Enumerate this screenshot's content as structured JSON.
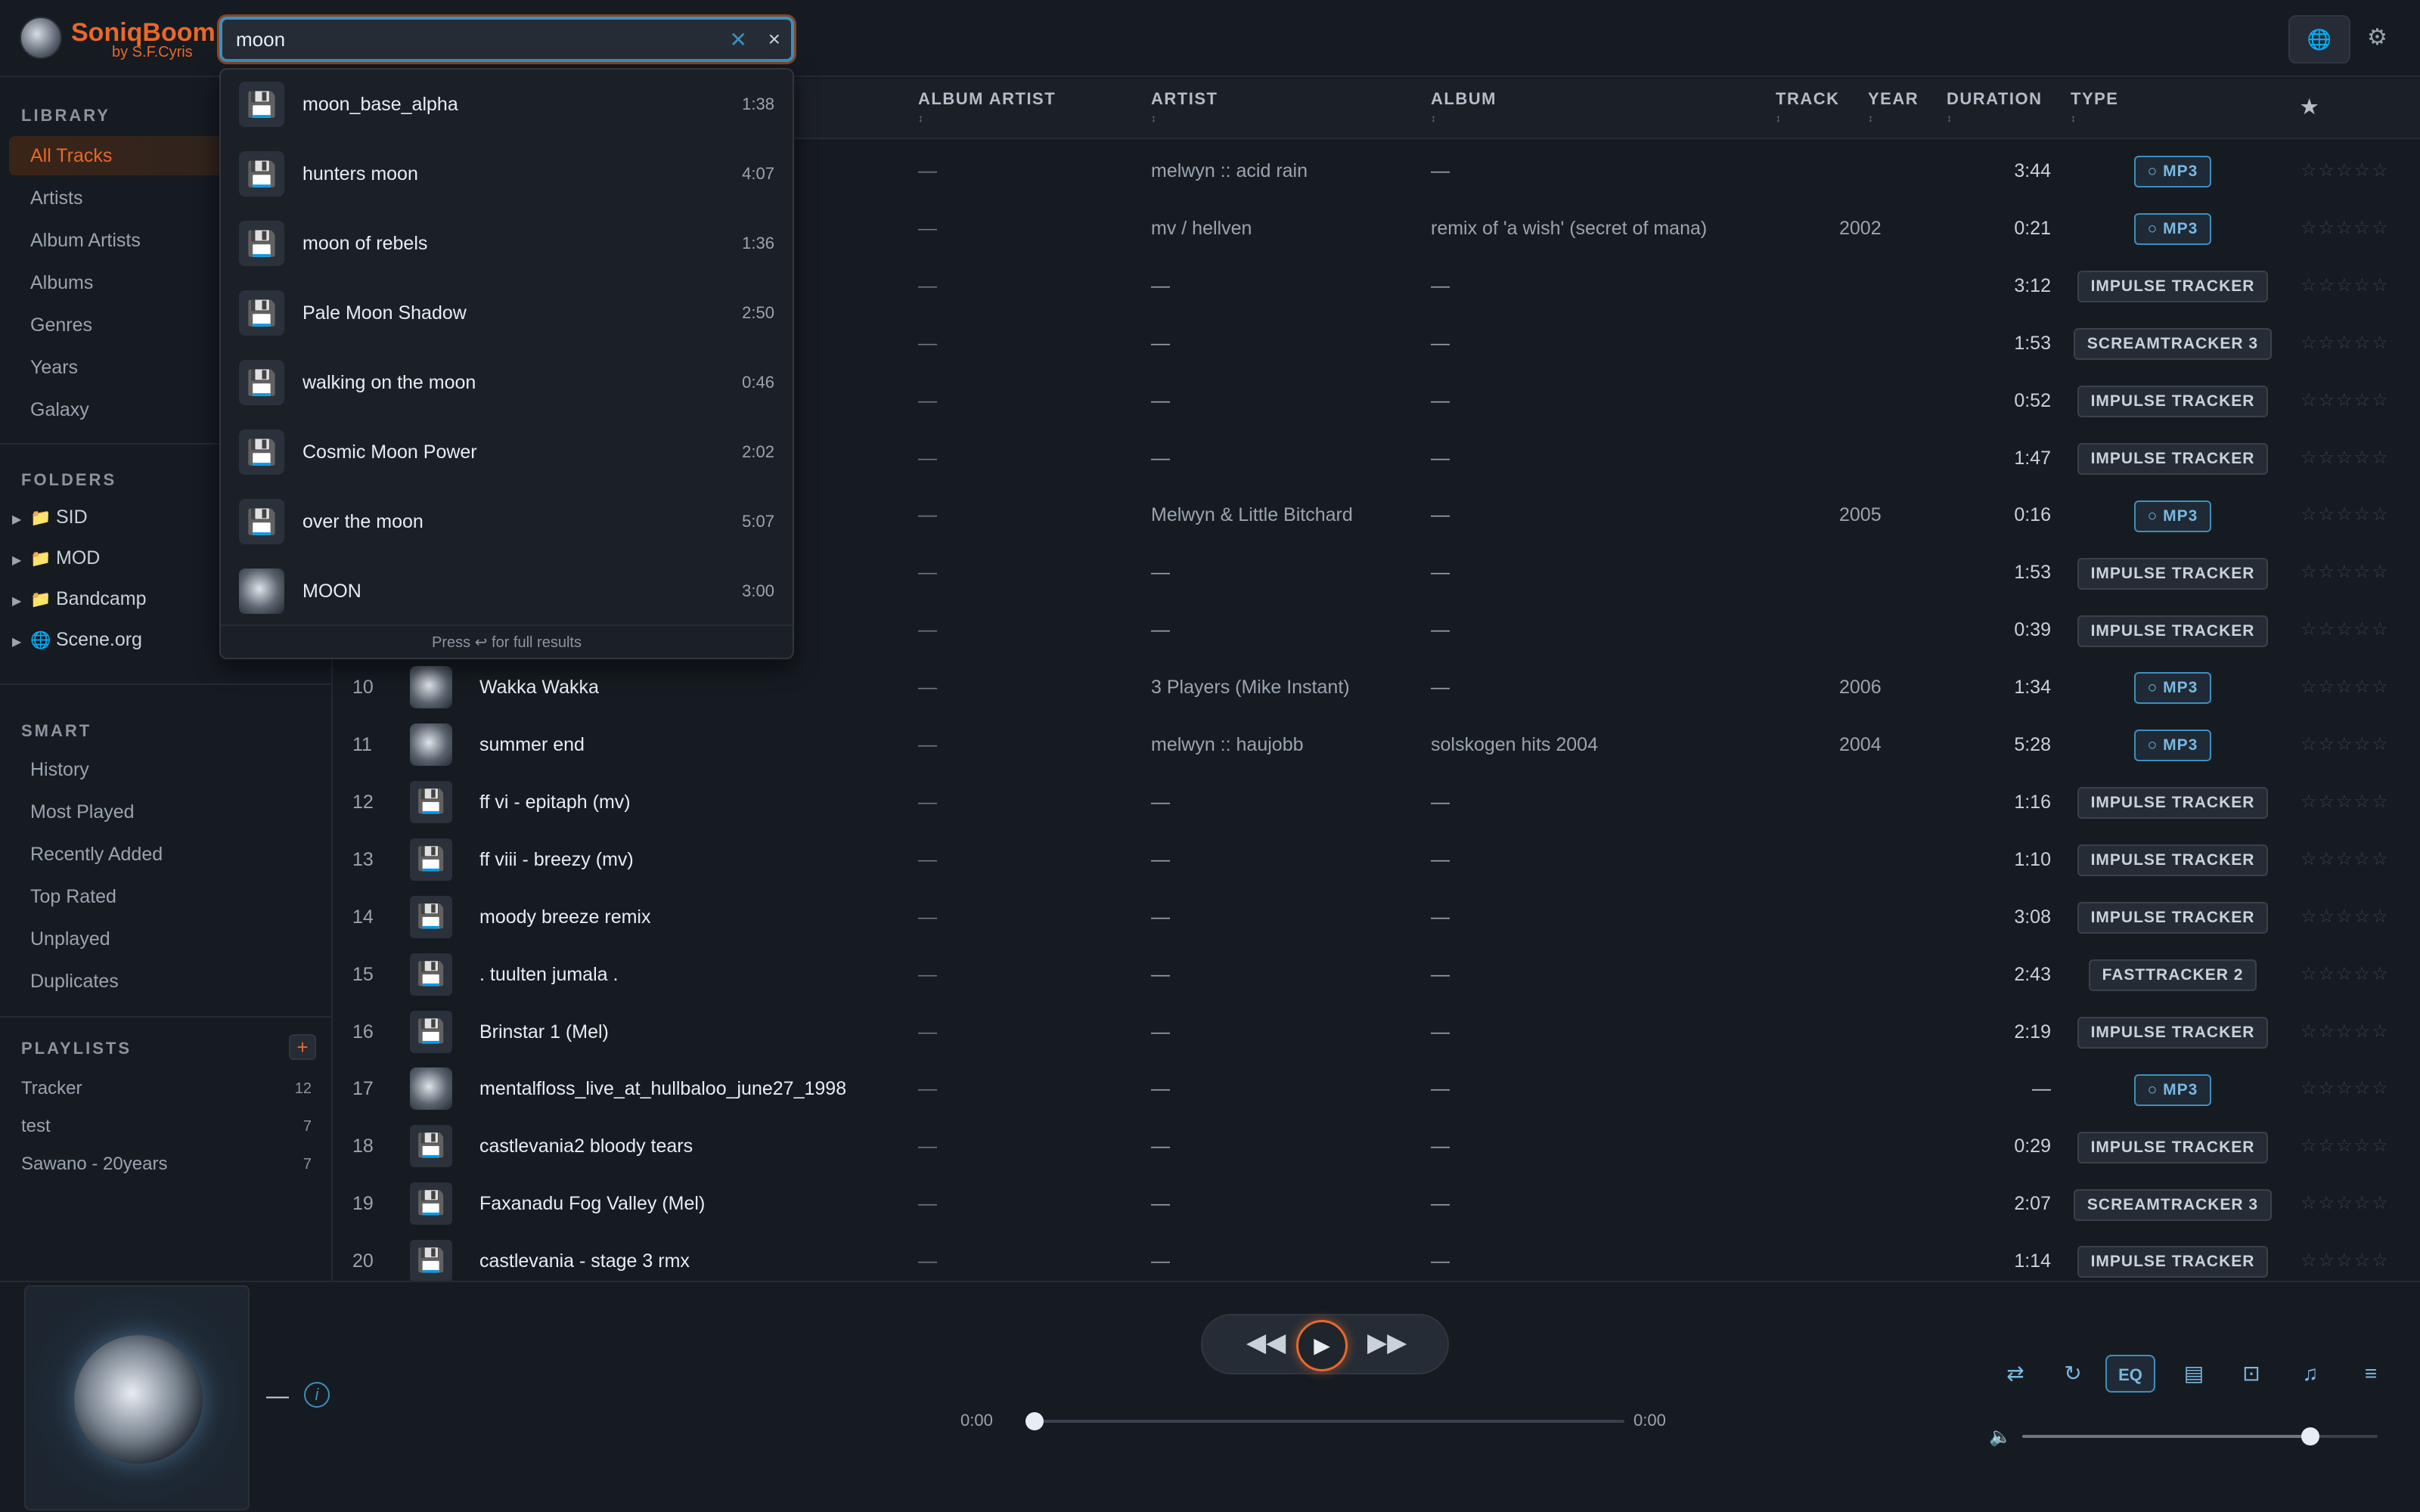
{
  "app": {
    "name": "SoniqBoom",
    "byline": "by S.F.Cyris"
  },
  "search": {
    "value": "moon",
    "clear_icon": "✕",
    "close_icon": "×"
  },
  "sidebar": {
    "library_title": "LIBRARY",
    "library": [
      "All Tracks",
      "Artists",
      "Album Artists",
      "Albums",
      "Genres",
      "Years",
      "Galaxy"
    ],
    "folders_title": "FOLDERS",
    "folders": [
      {
        "name": "SID",
        "icon": "folder-icon"
      },
      {
        "name": "MOD",
        "icon": "folder-icon"
      },
      {
        "name": "Bandcamp",
        "icon": "folder-icon"
      },
      {
        "name": "Scene.org",
        "icon": "globe-icon"
      }
    ],
    "smart_title": "SMART",
    "smart": [
      "History",
      "Most Played",
      "Recently Added",
      "Top Rated",
      "Unplayed",
      "Duplicates"
    ],
    "playlists_title": "PLAYLISTS",
    "add_label": "+",
    "playlists": [
      {
        "name": "Tracker",
        "count": "12"
      },
      {
        "name": "test",
        "count": "7"
      },
      {
        "name": "Sawano - 20years",
        "count": "7"
      }
    ]
  },
  "table": {
    "headers": {
      "album_artist": "ALBUM ARTIST",
      "artist": "ARTIST",
      "album": "ALBUM",
      "track": "TRACK",
      "year": "YEAR",
      "duration": "DURATION",
      "type": "TYPE",
      "rating": "★"
    },
    "sort_glyph": "↕",
    "rows": [
      {
        "num": "",
        "title": "",
        "album_artist": "—",
        "artist": "melwyn :: acid rain",
        "album": "—",
        "year": "",
        "duration": "3:44",
        "type": "MP3",
        "kind": "mp3"
      },
      {
        "num": "",
        "title": "",
        "album_artist": "—",
        "artist": "mv / hellven",
        "album": "remix of 'a wish' (secret of mana)",
        "year": "2002",
        "duration": "0:21",
        "type": "MP3",
        "kind": "mp3"
      },
      {
        "num": "",
        "title": "",
        "album_artist": "—",
        "artist": "—",
        "album": "—",
        "year": "",
        "duration": "3:12",
        "type": "IMPULSE TRACKER",
        "kind": "mod"
      },
      {
        "num": "",
        "title": "",
        "album_artist": "—",
        "artist": "—",
        "album": "—",
        "year": "",
        "duration": "1:53",
        "type": "SCREAMTRACKER 3",
        "kind": "mod"
      },
      {
        "num": "",
        "title": "",
        "album_artist": "—",
        "artist": "—",
        "album": "—",
        "year": "",
        "duration": "0:52",
        "type": "IMPULSE TRACKER",
        "kind": "mod"
      },
      {
        "num": "",
        "title": "",
        "album_artist": "—",
        "artist": "—",
        "album": "—",
        "year": "",
        "duration": "1:47",
        "type": "IMPULSE TRACKER",
        "kind": "mod"
      },
      {
        "num": "",
        "title": "",
        "album_artist": "—",
        "artist": "Melwyn & Little Bitchard",
        "album": "—",
        "year": "2005",
        "duration": "0:16",
        "type": "MP3",
        "kind": "mp3"
      },
      {
        "num": "",
        "title": "",
        "album_artist": "—",
        "artist": "—",
        "album": "—",
        "year": "",
        "duration": "1:53",
        "type": "IMPULSE TRACKER",
        "kind": "mod"
      },
      {
        "num": "",
        "title": "",
        "album_artist": "—",
        "artist": "—",
        "album": "—",
        "year": "",
        "duration": "0:39",
        "type": "IMPULSE TRACKER",
        "kind": "mod"
      },
      {
        "num": "10",
        "title": "Wakka Wakka",
        "album_artist": "—",
        "artist": "3 Players (Mike Instant)",
        "album": "—",
        "year": "2006",
        "duration": "1:34",
        "type": "MP3",
        "kind": "mp3"
      },
      {
        "num": "11",
        "title": "summer end",
        "album_artist": "—",
        "artist": "melwyn :: haujobb",
        "album": "solskogen hits 2004",
        "year": "2004",
        "duration": "5:28",
        "type": "MP3",
        "kind": "mp3"
      },
      {
        "num": "12",
        "title": "ff vi - epitaph (mv)",
        "album_artist": "—",
        "artist": "—",
        "album": "—",
        "year": "",
        "duration": "1:16",
        "type": "IMPULSE TRACKER",
        "kind": "mod"
      },
      {
        "num": "13",
        "title": "ff viii - breezy (mv)",
        "album_artist": "—",
        "artist": "—",
        "album": "—",
        "year": "",
        "duration": "1:10",
        "type": "IMPULSE TRACKER",
        "kind": "mod"
      },
      {
        "num": "14",
        "title": "moody breeze remix",
        "album_artist": "—",
        "artist": "—",
        "album": "—",
        "year": "",
        "duration": "3:08",
        "type": "IMPULSE TRACKER",
        "kind": "mod"
      },
      {
        "num": "15",
        "title": ". tuulten jumala .",
        "album_artist": "—",
        "artist": "—",
        "album": "—",
        "year": "",
        "duration": "2:43",
        "type": "FASTTRACKER 2",
        "kind": "mod"
      },
      {
        "num": "16",
        "title": "Brinstar 1 (Mel)",
        "album_artist": "—",
        "artist": "—",
        "album": "—",
        "year": "",
        "duration": "2:19",
        "type": "IMPULSE TRACKER",
        "kind": "mod"
      },
      {
        "num": "17",
        "title": "mentalfloss_live_at_hullbaloo_june27_1998",
        "album_artist": "—",
        "artist": "—",
        "album": "—",
        "year": "",
        "duration": "—",
        "type": "MP3",
        "kind": "mp3"
      },
      {
        "num": "18",
        "title": "castlevania2 bloody tears",
        "album_artist": "—",
        "artist": "—",
        "album": "—",
        "year": "",
        "duration": "0:29",
        "type": "IMPULSE TRACKER",
        "kind": "mod"
      },
      {
        "num": "19",
        "title": "Faxanadu Fog Valley (Mel)",
        "album_artist": "—",
        "artist": "—",
        "album": "—",
        "year": "",
        "duration": "2:07",
        "type": "SCREAMTRACKER 3",
        "kind": "mod"
      },
      {
        "num": "20",
        "title": "castlevania - stage 3 rmx",
        "album_artist": "—",
        "artist": "—",
        "album": "—",
        "year": "",
        "duration": "1:14",
        "type": "IMPULSE TRACKER",
        "kind": "mod"
      }
    ]
  },
  "dropdown": {
    "items": [
      {
        "name": "moon_base_alpha",
        "duration": "1:38",
        "kind": "mod"
      },
      {
        "name": "hunters moon",
        "duration": "4:07",
        "kind": "mod"
      },
      {
        "name": "moon of rebels",
        "duration": "1:36",
        "kind": "mod"
      },
      {
        "name": "Pale Moon Shadow",
        "duration": "2:50",
        "kind": "mod"
      },
      {
        "name": "walking on the moon",
        "duration": "0:46",
        "kind": "mod"
      },
      {
        "name": "Cosmic Moon Power",
        "duration": "2:02",
        "kind": "mod"
      },
      {
        "name": "over the moon",
        "duration": "5:07",
        "kind": "mod"
      },
      {
        "name": "MOON",
        "duration": "3:00",
        "kind": "mp3"
      }
    ],
    "footer": "Press ↩ for full results"
  },
  "player": {
    "now_playing": "—",
    "time_current": "0:00",
    "time_total": "0:00",
    "progress": 0,
    "volume": 0.81,
    "eq_label": "EQ",
    "icons": [
      "shuffle-icon",
      "repeat-icon",
      "eq-icon",
      "lyrics-icon",
      "cast-icon",
      "visualizer-icon",
      "queue-icon"
    ]
  },
  "colors": {
    "accent": "#e8682a",
    "link": "#3d8fbe",
    "bg": "#161b22"
  }
}
